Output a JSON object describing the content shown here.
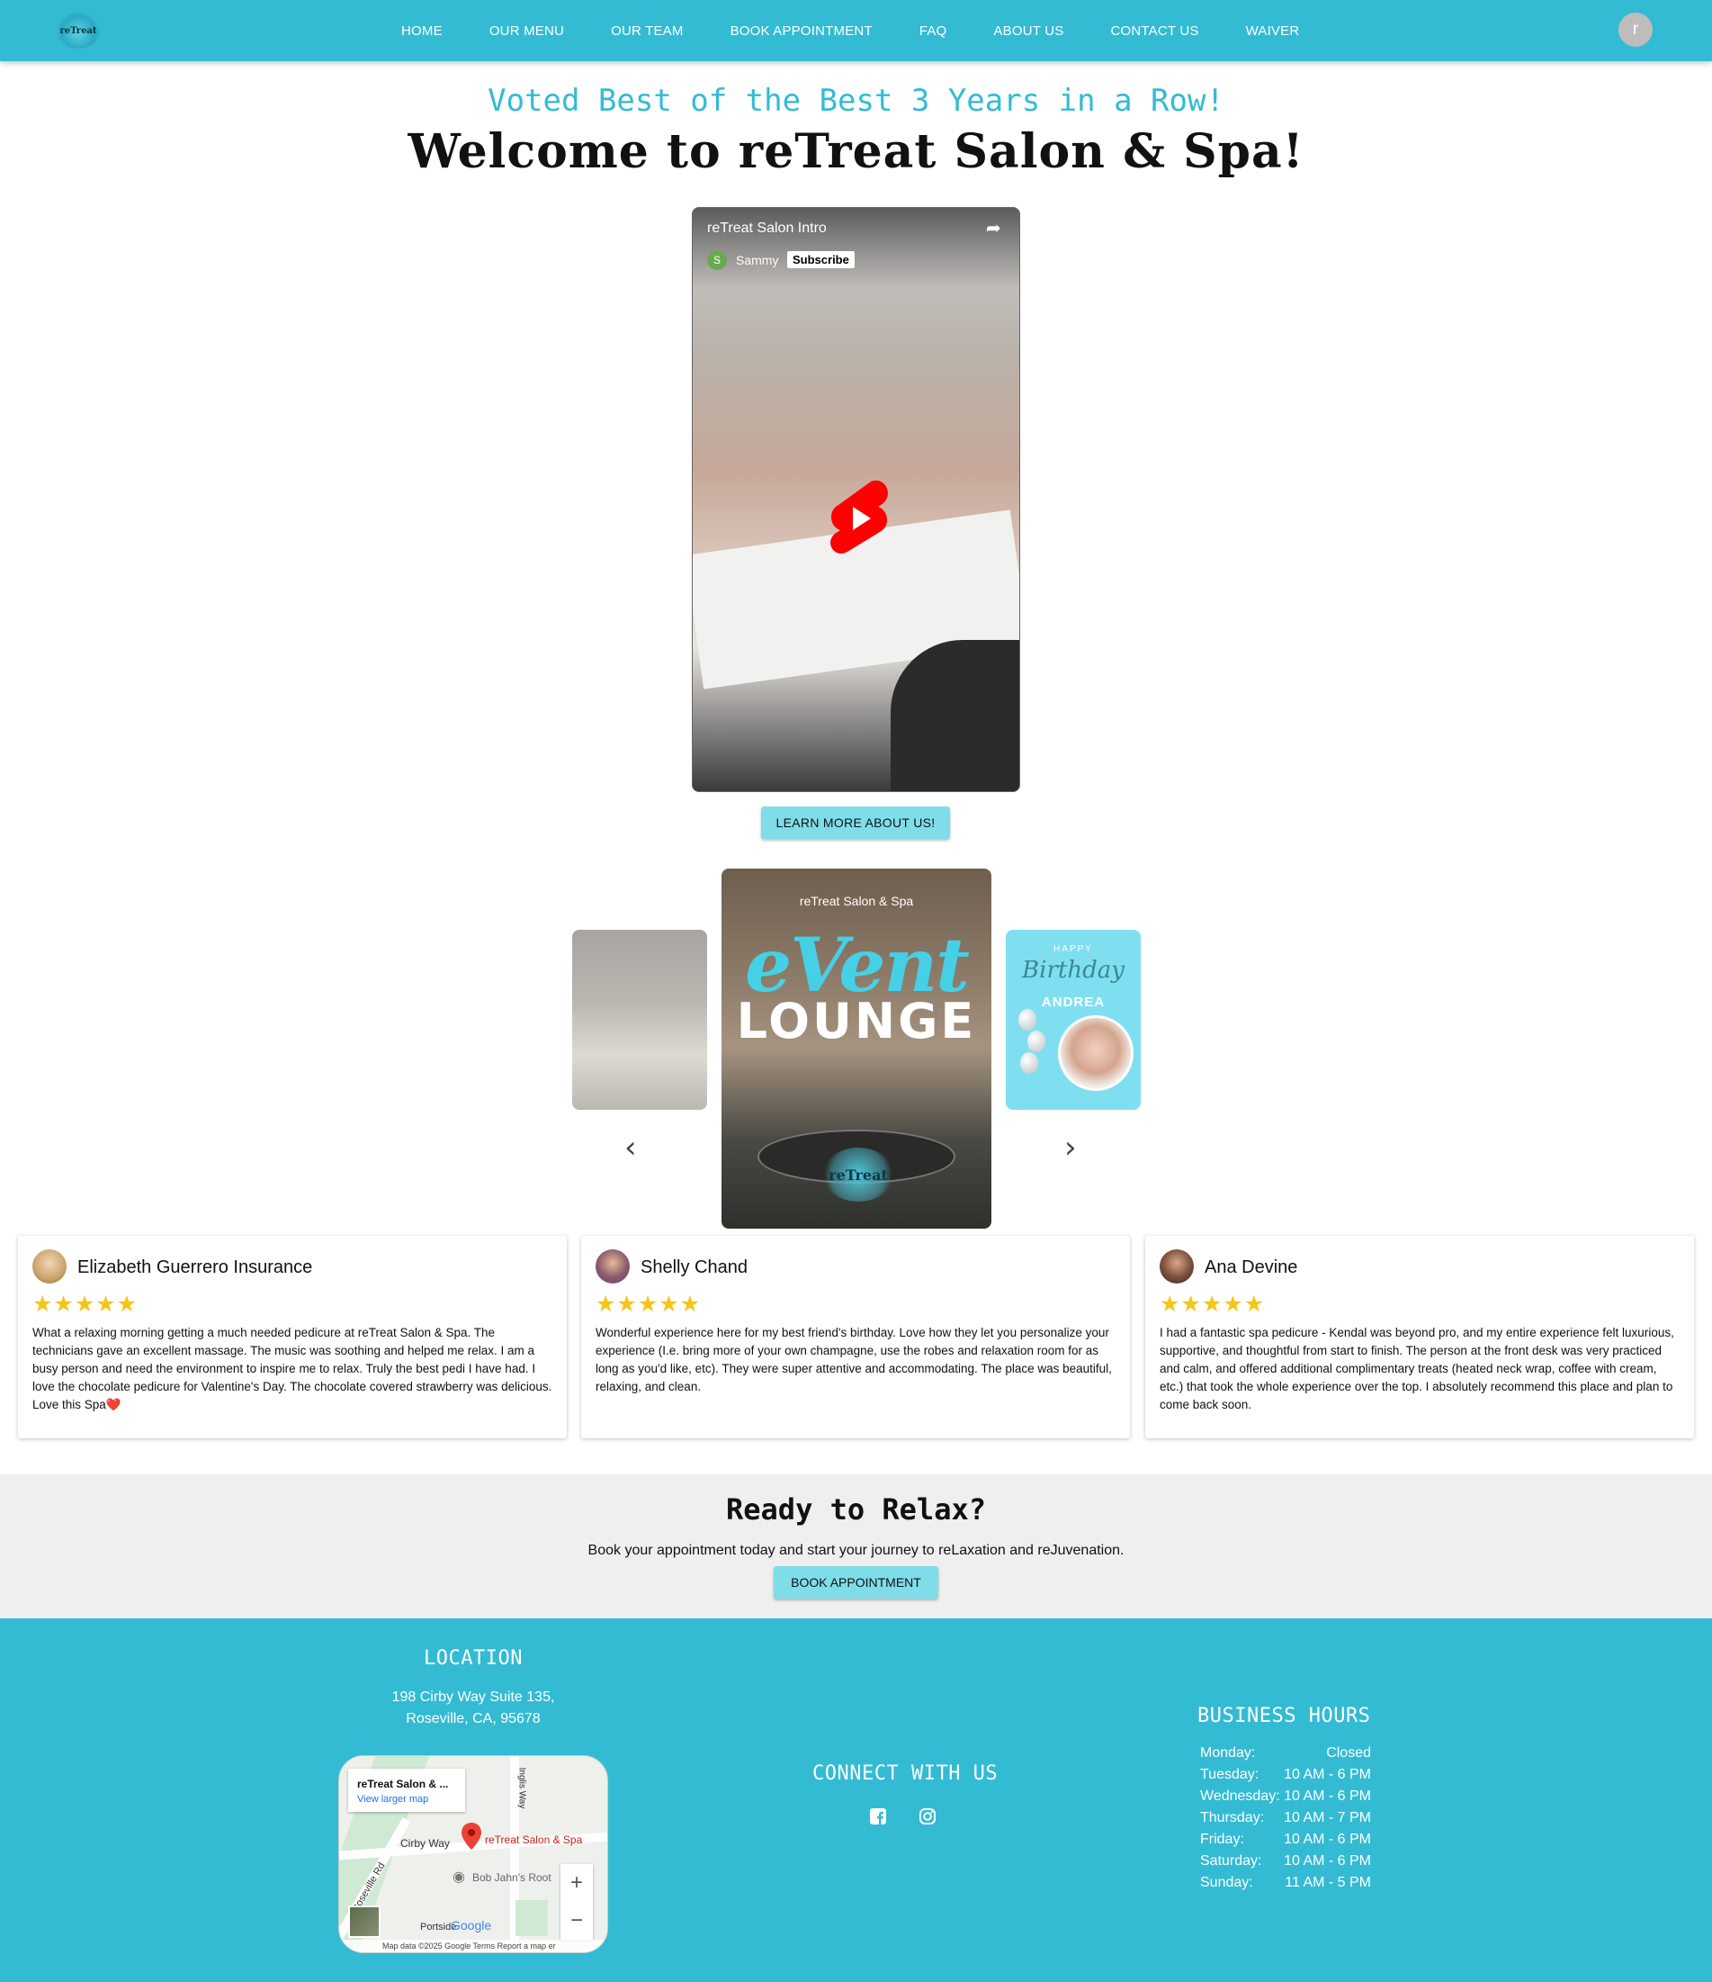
{
  "nav": {
    "logo_text": "reTreat",
    "links": [
      "HOME",
      "OUR MENU",
      "OUR TEAM",
      "BOOK APPOINTMENT",
      "FAQ",
      "ABOUT US",
      "CONTACT US",
      "WAIVER"
    ],
    "avatar_letter": "r"
  },
  "hero": {
    "tagline": "Voted Best of the Best 3 Years in a Row!",
    "title": "Welcome to reTreat Salon & Spa!"
  },
  "video": {
    "title": "reTreat Salon Intro",
    "channel_initial": "S",
    "channel_name": "Sammy",
    "subscribe_label": "Subscribe",
    "share_icon": "share-icon",
    "play_icon": "youtube-shorts-play-icon"
  },
  "learn_more_label": "LEARN MORE ABOUT US!",
  "carousel": {
    "main": {
      "brand": "reTreat Salon & Spa",
      "headline": "eVent",
      "subheadline": "LOUNGE",
      "logo_text": "reTreat"
    },
    "right": {
      "happy": "HAPPY",
      "script": "Birthday",
      "name": "ANDREA"
    },
    "prev_icon": "chevron-left-icon",
    "next_icon": "chevron-right-icon"
  },
  "reviews": [
    {
      "name": "Elizabeth Guerrero Insurance",
      "stars": "★★★★★",
      "rating": 5,
      "text": "What a relaxing morning getting a much needed pedicure at reTreat Salon & Spa. The technicians gave an excellent massage. The music was soothing and helped me relax. I am a busy person and need the environment to inspire me to relax. Truly the best pedi I have had. I love the chocolate pedicure for Valentine's Day. The chocolate covered strawberry was delicious. Love this Spa❤️",
      "avatar_color": "#c9a36a"
    },
    {
      "name": "Shelly Chand",
      "stars": "★★★★★",
      "rating": 5,
      "text": "Wonderful experience here for my best friend's birthday. Love how they let you personalize your experience (I.e. bring more of your own champagne, use the robes and relaxation room for as long as you'd like, etc). They were super attentive and accommodating. The place was beautiful, relaxing, and clean.",
      "avatar_color": "#6b3f8c"
    },
    {
      "name": "Ana Devine",
      "stars": "★★★★★",
      "rating": 5,
      "text": "I had a fantastic spa pedicure - Kendal was beyond pro, and my entire experience felt luxurious, supportive, and thoughtful from start to finish. The person at the front desk was very practiced and calm, and offered additional complimentary treats (heated neck wrap, coffee with cream, etc.) that took the whole experience over the top. I absolutely recommend this place and plan to come back soon.",
      "avatar_color": "#5a3b2e"
    }
  ],
  "cta": {
    "title": "Ready to Relax?",
    "text": "Book your appointment today and start your journey to reLaxation and reJuvenation.",
    "button": "BOOK APPOINTMENT"
  },
  "footer": {
    "location_title": "LOCATION",
    "address_line1": "198 Cirby Way Suite 135,",
    "address_line2": "Roseville, CA, 95678",
    "map": {
      "card_title": "reTreat Salon & ...",
      "card_link": "View larger map",
      "pin_label": "reTreat Salon & Spa",
      "street1": "Cirby Way",
      "street2": "Roseville Rd",
      "street3": "Inglis Way",
      "poi": "Bob Jahn's Root",
      "poi2": "Portside",
      "google": "Google",
      "attribution": "Map data ©2025 Google   Terms   Report a map er",
      "zoom_in": "+",
      "zoom_out": "−"
    },
    "connect_title": "CONNECT WITH US",
    "social_icons": [
      "facebook-icon",
      "instagram-icon"
    ],
    "hours_title": "BUSINESS HOURS",
    "hours": [
      {
        "day": "Monday:",
        "time": "Closed"
      },
      {
        "day": "Tuesday:",
        "time": "10 AM - 6 PM"
      },
      {
        "day": "Wednesday:",
        "time": "10 AM - 6 PM"
      },
      {
        "day": "Thursday:",
        "time": "10 AM - 7 PM"
      },
      {
        "day": "Friday:",
        "time": "10 AM - 6 PM"
      },
      {
        "day": "Saturday:",
        "time": "10 AM - 6 PM"
      },
      {
        "day": "Sunday:",
        "time": "11 AM - 5 PM"
      }
    ]
  },
  "colors": {
    "brand_teal": "#33bbd4",
    "button_teal": "#7fdde9",
    "star_gold": "#f5c518",
    "cta_bg": "#efefef"
  }
}
